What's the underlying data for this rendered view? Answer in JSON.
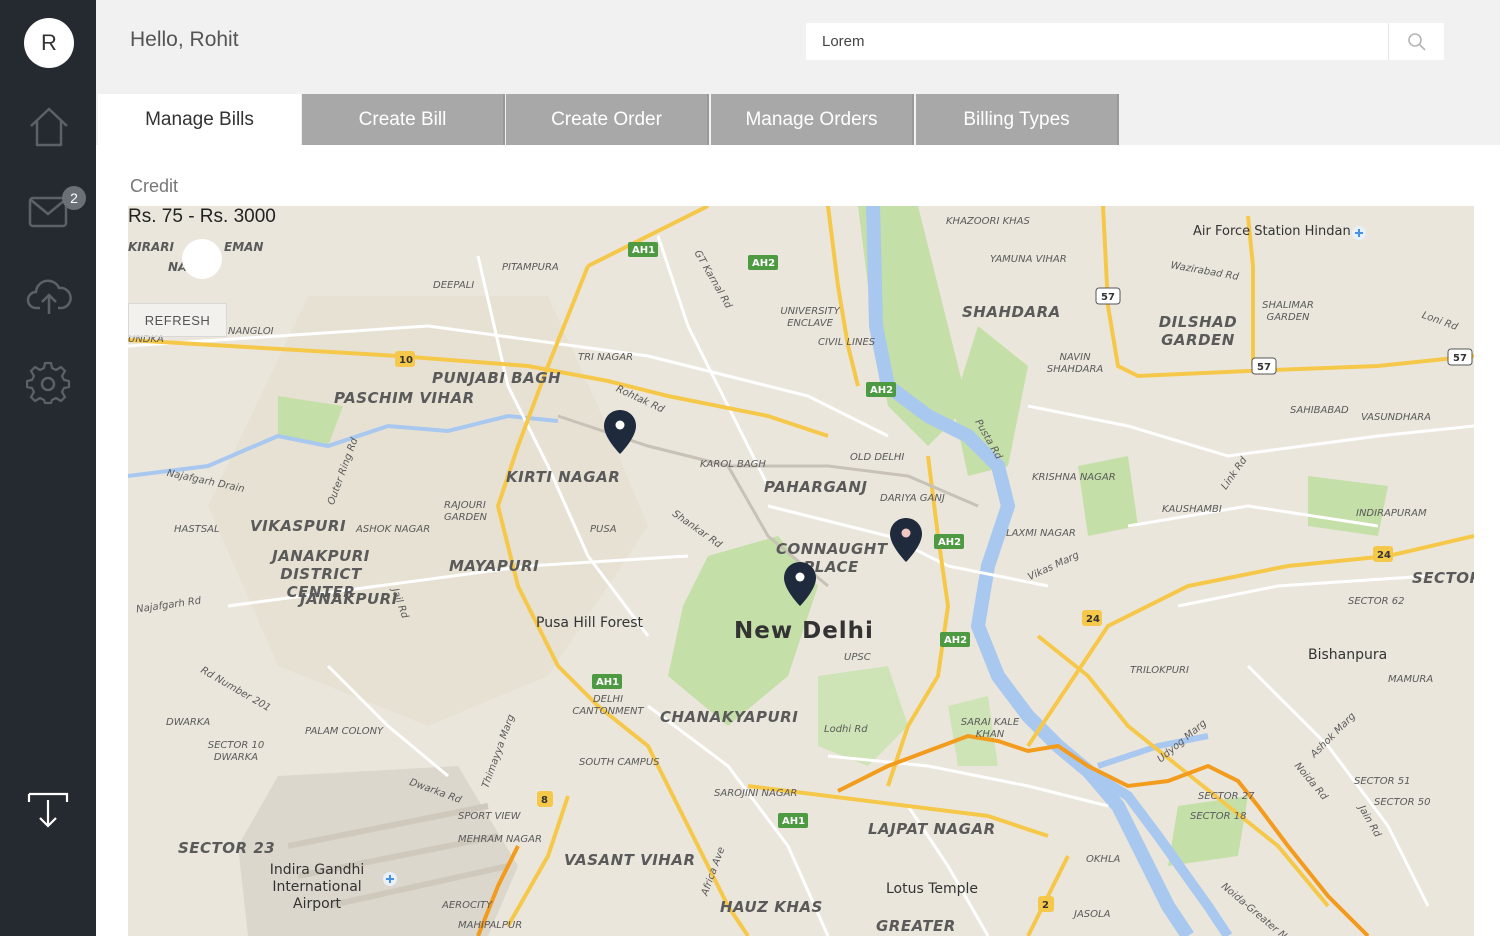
{
  "user": {
    "avatar_initial": "R",
    "greeting": "Hello, Rohit"
  },
  "sidebar": {
    "items": [
      {
        "name": "home",
        "icon": "home-icon"
      },
      {
        "name": "messages",
        "icon": "mail-icon",
        "badge": "2"
      },
      {
        "name": "upload",
        "icon": "cloud-upload-icon"
      },
      {
        "name": "settings",
        "icon": "gear-icon"
      }
    ],
    "bottom_icon": "download-icon"
  },
  "search": {
    "value": "Lorem",
    "icon": "search-icon"
  },
  "tabs": [
    {
      "label": "Manage Bills",
      "active": true
    },
    {
      "label": "Create Bill",
      "active": false
    },
    {
      "label": "Create Order",
      "active": false
    },
    {
      "label": "Manage Orders",
      "active": false
    },
    {
      "label": "Billing Types",
      "active": false
    }
  ],
  "filter": {
    "label": "Credit",
    "range_text": "Rs. 75 - Rs. 3000",
    "refresh_label": "REFRESH"
  },
  "map": {
    "city": "New Delhi",
    "labels": {
      "kirari": "KIRARI",
      "suleman": "EMAN",
      "na": "NA",
      "pitampura": "PITAMPURA",
      "deepali": "DEEPALI",
      "nangloi": "NANGLOI",
      "mundka": "UNDKA",
      "punjabi_bagh": "PUNJABI BAGH",
      "paschim_vihar": "PASCHIM VIHAR",
      "tri_nagar": "TRI NAGAR",
      "kirti_nagar": "KIRTI NAGAR",
      "rajouri": "RAJOURI GARDEN",
      "vikaspuri": "VIKASPURI",
      "hastsal": "HASTSAL",
      "ashok_nagar": "ASHOK NAGAR",
      "janakpuri_dc": "JANAKPURI DISTRICT CENTER",
      "janakpuri": "JANAKPURI",
      "mayapuri": "MAYAPURI",
      "pusa": "PUSA",
      "karol_bagh": "KAROL BAGH",
      "paharganj": "PAHARGANJ",
      "old_delhi": "OLD DELHI",
      "daryaganj": "DARIYA GANJ",
      "connaught": "CONNAUGHT PLACE",
      "upsc": "UPSC",
      "university": "UNIVERSITY ENCLAVE",
      "civil_lines": "CIVIL LINES",
      "khazoori": "KHAZOORI KHAS",
      "yamuna_vihar": "YAMUNA VIHAR",
      "shahdara": "SHAHDARA",
      "dilshad": "DILSHAD GARDEN",
      "shalimar": "SHALIMAR GARDEN",
      "navin": "NAVIN SHAHDARA",
      "sahibabad": "SAHIBABAD",
      "vasundhara": "VASUNDHARA",
      "krishna_nagar": "KRISHNA NAGAR",
      "kaushambi": "KAUSHAMBI",
      "indirapuram": "INDIRAPURAM",
      "laxmi_nagar": "LAXMI NAGAR",
      "sector": "SECTOR",
      "sector62": "SECTOR 62",
      "bishanpura": "Bishanpura",
      "mamura": "MAMURA",
      "trilokpuri": "TRILOKPURI",
      "sarai": "SARAI KALE KHAN",
      "lodhi": "Lodhi Rd",
      "chanakyapuri": "CHANAKYAPURI",
      "delhi_cant": "DELHI CANTONMENT",
      "pusa_hill": "Pusa Hill Forest",
      "dwarka": "DWARKA",
      "sector10": "SECTOR 10 DWARKA",
      "palam": "PALAM COLONY",
      "south_campus": "SOUTH CAMPUS",
      "sarojini": "SAROJINI NAGAR",
      "lajpat": "LAJPAT NAGAR",
      "sport_view": "SPORT VIEW",
      "mehram": "MEHRAM NAGAR",
      "vasant_vihar": "VASANT VIHAR",
      "sector23": "SECTOR 23",
      "airport": "Indira Gandhi International Airport",
      "aerocity": "AEROCITY",
      "mahipalpur": "MAHIPALPUR",
      "hauz_khas": "HAUZ KHAS",
      "greater": "GREATER",
      "lotus": "Lotus Temple",
      "okhla": "OKHLA",
      "jasola": "JASOLA",
      "sector27": "SECTOR 27",
      "sector18": "SECTOR 18",
      "sector51": "SECTOR 51",
      "sector50": "SECTOR 50",
      "air_force": "Air Force Station Hindan",
      "wazirabad": "Wazirabad Rd",
      "loni": "Loni Rd",
      "najafgarh_drain": "Najafgarh Drain",
      "najafgarh_rd": "Najafgarh Rd",
      "rohtak_rd": "Rohtak Rd",
      "shankar_rd": "Shankar Rd",
      "vikas_marg": "Vikas Marg",
      "pusta_rd": "Pusta Rd",
      "gt_karnal": "GT Karnal Rd",
      "outer_ring": "Outer Ring Rd",
      "jail_rd": "Jail Rd",
      "dwarka_rd": "Dwarka Rd",
      "thimayya": "Thimayya Marg",
      "africa": "Africa Ave",
      "udyog": "Udyog Marg",
      "noida_rd": "Noida Rd",
      "jain_rd": "Jain Rd",
      "noida_greater": "Noida-Greater N",
      "link_rd": "Link Rd",
      "rd_201": "Rd Number 201",
      "ashok_marg": "Ashok Marg"
    },
    "shields": [
      "AH1",
      "AH2",
      "10",
      "57",
      "24",
      "8",
      "2"
    ],
    "pins": 3,
    "colors": {
      "highway": "#f6c84a",
      "river": "#a8c8f0",
      "park": "#c4dfa8",
      "metro": "#f29b1d",
      "pin": "#1f2a3d"
    }
  }
}
